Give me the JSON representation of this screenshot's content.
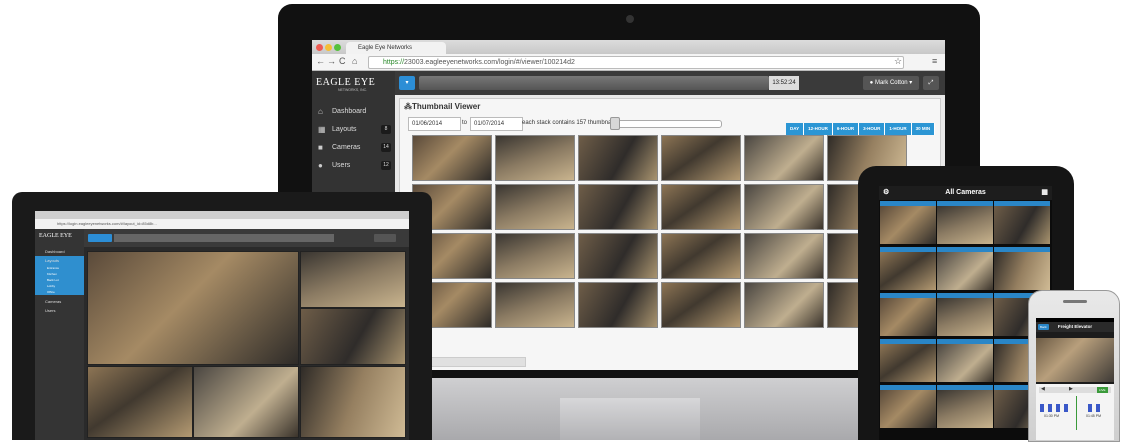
{
  "desktop": {
    "tab_title": "Eagle Eye Networks",
    "url_https": "https://",
    "url_rest": "23003.eagleeyenetworks.com/login/#/viewer/100214d2",
    "logo": {
      "name": "EAGLE EYE",
      "sub": "NETWORKS, INC."
    },
    "sidebar": [
      {
        "icon": "⌂",
        "label": "Dashboard",
        "badge": ""
      },
      {
        "icon": "▦",
        "label": "Layouts",
        "badge": "8"
      },
      {
        "icon": "■",
        "label": "Cameras",
        "badge": "14"
      },
      {
        "icon": "●",
        "label": "Users",
        "badge": "12"
      }
    ],
    "time": "13:52:24",
    "user": "Mark Cotton",
    "panel_title": "Thumbnail Viewer",
    "date_from": "01/06/2014",
    "date_to_label": "to",
    "date_to": "01/07/2014",
    "stack_text": "each stack contains 157 thumbnails",
    "ranges": [
      "DAY",
      "12-HOUR",
      "6-HOUR",
      "3-HOUR",
      "1-HOUR",
      "30 MIN"
    ]
  },
  "laptop": {
    "url": "https://login.eagleeyenetworks.com/#/layout_id=85d8b...",
    "logo": "EAGLE EYE",
    "nav": [
      "Dashboard",
      "Layouts",
      "Cameras",
      "Users"
    ],
    "layouts": [
      "Entrance",
      "Kitchen",
      "Back Lot",
      "Lobby",
      "Office"
    ]
  },
  "tablet": {
    "title": "All Cameras"
  },
  "phone": {
    "title": "Freight Elevator",
    "back": "Back",
    "times": [
      "01:30 PM",
      "01:45 PM"
    ],
    "live": "LIVE"
  }
}
